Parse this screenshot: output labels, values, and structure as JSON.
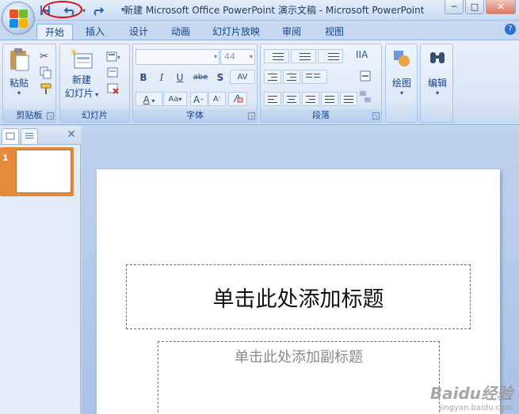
{
  "window": {
    "title": "新建 Microsoft Office PowerPoint 演示文稿 - Microsoft PowerPoint",
    "controls": [
      "─",
      "□",
      "✕"
    ]
  },
  "quick_access": {
    "icons": [
      "save-icon",
      "undo-icon",
      "redo-icon",
      "customize-dropdown-icon"
    ],
    "annotation_color": "#e60012"
  },
  "tabs": [
    {
      "label": "开始",
      "active": true
    },
    {
      "label": "插入",
      "active": false
    },
    {
      "label": "设计",
      "active": false
    },
    {
      "label": "动画",
      "active": false
    },
    {
      "label": "幻灯片放映",
      "active": false
    },
    {
      "label": "审阅",
      "active": false
    },
    {
      "label": "视图",
      "active": false
    }
  ],
  "help_label": "?",
  "ribbon": {
    "clipboard": {
      "label": "剪贴板",
      "paste": "粘贴"
    },
    "slides": {
      "label": "幻灯片",
      "new_slide_line1": "新建",
      "new_slide_line2": "幻灯片"
    },
    "font": {
      "label": "字体",
      "font_name": "",
      "font_size": "44",
      "buttons": [
        "B",
        "I",
        "U",
        "abe",
        "S",
        "AV",
        "A",
        "Aa",
        "A",
        "A"
      ]
    },
    "paragraph": {
      "label": "段落"
    },
    "drawing": {
      "label": "绘图"
    },
    "editing": {
      "label": "编辑"
    }
  },
  "left_pane": {
    "close": "✕",
    "slide_number": "1"
  },
  "slide": {
    "title_placeholder": "单击此处添加标题",
    "subtitle_placeholder": "单击此处添加副标题"
  },
  "watermark": {
    "brand": "Baidu经验",
    "url": "jingyan.baidu.com"
  },
  "colors": {
    "accent": "#15428b",
    "selection": "#e48b3a",
    "ribbon_bg": "#dae6f5"
  }
}
